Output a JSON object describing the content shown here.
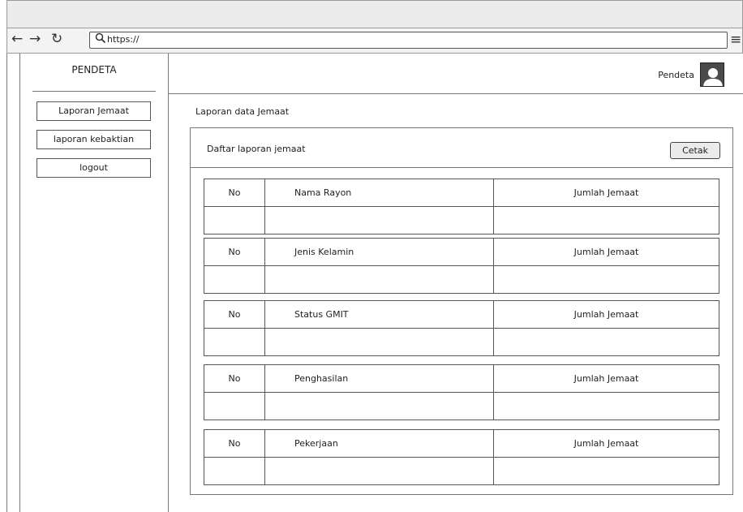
{
  "browser": {
    "url": "https://",
    "nav_icons": [
      "back-arrow-icon",
      "forward-arrow-icon",
      "reload-icon"
    ]
  },
  "sidebar": {
    "title": "PENDETA",
    "items": [
      {
        "label": "Laporan Jemaat"
      },
      {
        "label": "laporan kebaktian"
      },
      {
        "label": "logout"
      }
    ]
  },
  "header": {
    "user_name": "Pendeta"
  },
  "main": {
    "page_title": "Laporan data Jemaat",
    "panel_title": "Daftar laporan jemaat",
    "print_label": "Cetak",
    "tables": [
      {
        "no": "No",
        "category": "Nama Rayon",
        "count": "Jumlah Jemaat"
      },
      {
        "no": "No",
        "category": "Jenis Kelamin",
        "count": "Jumlah Jemaat"
      },
      {
        "no": "No",
        "category": "Status GMIT",
        "count": "Jumlah Jemaat"
      },
      {
        "no": "No",
        "category": "Penghasilan",
        "count": "Jumlah Jemaat"
      },
      {
        "no": "No",
        "category": "Pekerjaan",
        "count": "Jumlah Jemaat"
      }
    ]
  },
  "colors": {
    "border": "#777777",
    "chrome": "#ececec",
    "avatar": "#4a4a4a"
  }
}
